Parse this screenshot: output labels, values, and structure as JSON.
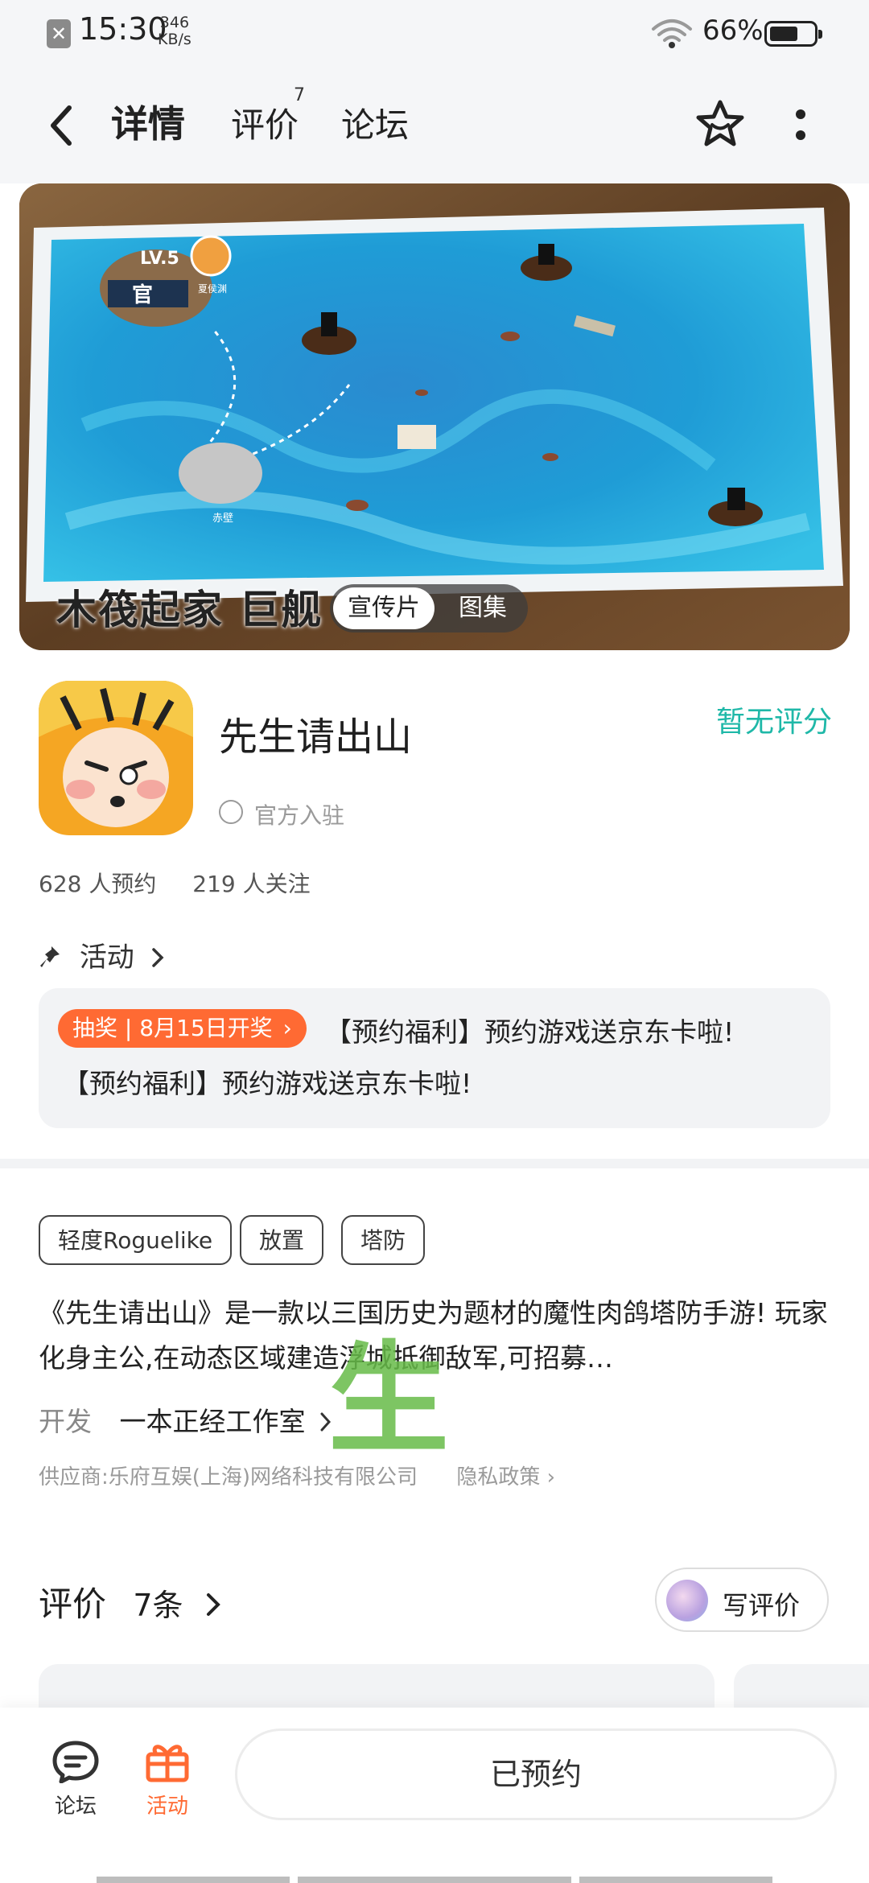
{
  "status_bar": {
    "time": "15:30",
    "net_speed_value": "346",
    "net_speed_unit": "KB/s",
    "battery": "66%",
    "battery_level": 0.66
  },
  "header": {
    "tabs": [
      {
        "label": "详情",
        "active": true
      },
      {
        "label": "评价",
        "badge": "7"
      },
      {
        "label": "论坛"
      }
    ],
    "accent": "#1fc8b8"
  },
  "banner": {
    "overlay_text": "木筏起家 巨舰",
    "map_labels": {
      "level": "LV.5",
      "player": "夏侯渊",
      "place": "赤壁",
      "banner_word": "官"
    },
    "switch": {
      "active": "宣传片",
      "inactive": "图集"
    }
  },
  "app": {
    "name": "先生请出山",
    "rating": "暂无评分",
    "official": "官方入驻",
    "reservations": "628 人预约",
    "followers": "219 人关注"
  },
  "activity": {
    "heading": "活动",
    "badge": "抽奖 | 8月15日开奖",
    "line1": "【预约福利】预约游戏送京东卡啦!",
    "line2": "【预约福利】预约游戏送京东卡啦!",
    "badge_color": "#ff6a33"
  },
  "tags": [
    "轻度Roguelike",
    "放置",
    "塔防"
  ],
  "description": "《先生请出山》是一款以三国历史为题材的魔性肉鸽塔防手游! 玩家化身主公,在动态区域建造浮城抵御敌军,可招募…",
  "developer": {
    "label": "开发",
    "value": "一本正经工作室"
  },
  "supplier": {
    "label": "供应商:乐府互娱(上海)网络科技有限公司",
    "privacy": "隐私政策"
  },
  "watermark": "生",
  "reviews": {
    "title": "评价",
    "count": "7条",
    "write_label": "写评价"
  },
  "bottom_bar": {
    "forum_label": "论坛",
    "activity_label": "活动",
    "reserve_label": "已预约",
    "activity_color": "#ff6a33"
  }
}
